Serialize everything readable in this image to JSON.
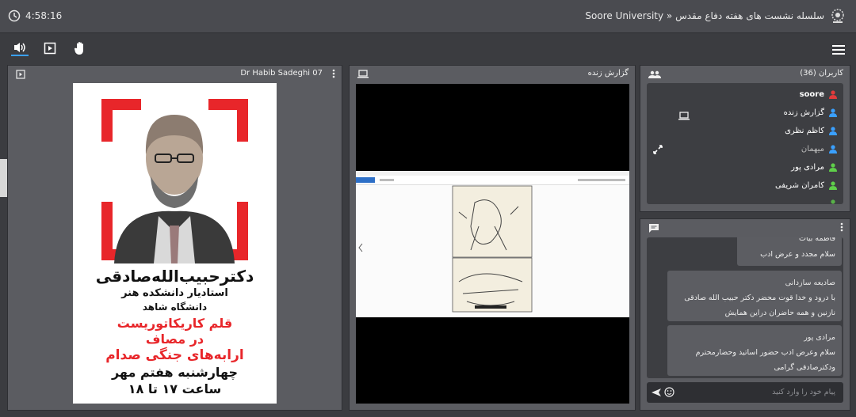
{
  "header": {
    "time": "4:58:16",
    "title": "سلسله نشست های هفته دفاع مقدس « Soore University"
  },
  "toolbar": {
    "items": [
      "speaker-icon",
      "presentation-icon",
      "raise-hand-icon"
    ],
    "menu": "hamburger-menu-icon"
  },
  "presentation": {
    "title": "Dr Habib Sadeghi 07",
    "poster": {
      "name": "دکترحبیب‌الله‌صادقی",
      "line1": "استادیار دانشکده هنر",
      "line2": "دانشگاه شاهد",
      "red1": "قلم کاریکاتوریست",
      "red2": "در مصاف",
      "red3": "ارابه‌های جنگی صدام",
      "date": "چهارشنبه هفتم مهر",
      "time": "ساعت ۱۷ تا ۱۸"
    }
  },
  "screenshare": {
    "title": "گزارش زنده"
  },
  "users": {
    "title": "کاربران (36)",
    "list": [
      {
        "name": "soore",
        "color": "#e23b3b"
      },
      {
        "name": "گزارش زنده",
        "color": "#3aa0ff"
      },
      {
        "name": "کاظم نظری",
        "color": "#3aa0ff"
      },
      {
        "name": "میهمان",
        "color": "#3aa0ff"
      },
      {
        "name": "مرادی پور",
        "color": "#5fd04a"
      },
      {
        "name": "کامران شریفی",
        "color": "#5fd04a"
      }
    ]
  },
  "chat": {
    "messages": [
      {
        "name": "فاطمه بیات",
        "text": "سلام مجدد و عرض ادب"
      },
      {
        "name": "صادیعه سازدانی",
        "text": "با درود و خدا قوت محضر دکتر حبیب الله صادقی نازنین و همه حاضران دراین همایش"
      },
      {
        "name": "مرادی پور",
        "text": "سلام وعرض ادب حضور اساتید وحضارمحترم ودکترصادقی گرامی"
      }
    ],
    "placeholder": "پیام خود را وارد کنید"
  }
}
